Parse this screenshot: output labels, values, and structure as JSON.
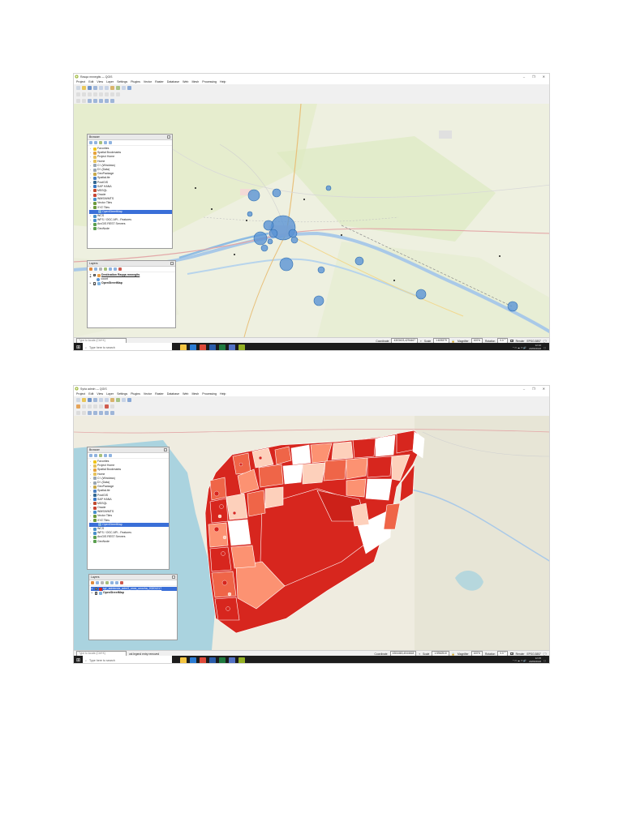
{
  "screenshot1": {
    "window_title": "Rasqa mnnegits — QGIS",
    "window_controls": [
      "–",
      "❐",
      "✕"
    ],
    "menu": [
      "Project",
      "Edit",
      "View",
      "Layer",
      "Settings",
      "Plugins",
      "Vector",
      "Raster",
      "Database",
      "Web",
      "Mesh",
      "Processing",
      "Help"
    ],
    "browser_panel": {
      "title": "Browser",
      "items": [
        {
          "label": "Favorites",
          "icon": "star-icon",
          "color": "#f0c419"
        },
        {
          "label": "Spatial Bookmarks",
          "icon": "bookmark-icon",
          "color": "#e6a23c"
        },
        {
          "label": "Project Home",
          "icon": "folder-icon",
          "color": "#e6c15a"
        },
        {
          "label": "Home",
          "icon": "folder-icon",
          "color": "#e6c15a"
        },
        {
          "label": "C:\\ (Windows)",
          "icon": "drive-icon",
          "color": "#9aa6b2"
        },
        {
          "label": "D:\\ (Data)",
          "icon": "drive-icon",
          "color": "#9aa6b2"
        },
        {
          "label": "GeoPackage",
          "icon": "geopackage-icon",
          "color": "#c7a84a"
        },
        {
          "label": "SpatiaLite",
          "icon": "spatialite-icon",
          "color": "#4a7fc1"
        },
        {
          "label": "PostGIS",
          "icon": "postgis-icon",
          "color": "#336791"
        },
        {
          "label": "SAP HANA",
          "icon": "database-icon",
          "color": "#3a78c3"
        },
        {
          "label": "MSSQL",
          "icon": "database-icon",
          "color": "#c14b2f"
        },
        {
          "label": "Oracle",
          "icon": "database-icon",
          "color": "#c74634"
        },
        {
          "label": "WMS/WMTS",
          "icon": "globe-icon",
          "color": "#4a8fc9"
        },
        {
          "label": "Vector Tiles",
          "icon": "grid-icon",
          "color": "#6c9a3c"
        },
        {
          "label": "XYZ Tiles",
          "icon": "grid-icon",
          "color": "#6c9a3c"
        },
        {
          "label": "OpenStreetMap",
          "icon": "map-icon",
          "color": "#7fb3e0",
          "selected": true
        },
        {
          "label": "WCS",
          "icon": "globe-icon",
          "color": "#4a8fc9"
        },
        {
          "label": "WFS / OGC API - Features",
          "icon": "globe-icon",
          "color": "#4a8fc9"
        },
        {
          "label": "ArcGIS REST Servers",
          "icon": "globe-icon",
          "color": "#5a9f4f"
        },
        {
          "label": "GeoNode",
          "icon": "globe-icon",
          "color": "#5a9f4f"
        }
      ]
    },
    "layers_panel": {
      "title": "Layers",
      "layers": [
        {
          "label": "Destination Raqqa mnnegits",
          "checked": true,
          "bold": true
        },
        {
          "label": "count",
          "checked": false,
          "legend": true
        },
        {
          "label": "OpenStreetMap",
          "checked": true,
          "bold": false
        }
      ]
    },
    "status": {
      "search_placeholder": "Type to locate (Ctrl+K)",
      "coordinate_label": "Coordinate",
      "coordinate_value": "4303403,4294467",
      "scale_label": "Scale",
      "scale_value": "1:605379",
      "magnifier_label": "Magnifier",
      "magnifier_value": "100%",
      "rotation_label": "Rotation",
      "rotation_value": "0.0 °",
      "render_label": "Render",
      "crs": "EPSG:3857"
    },
    "taskbar": {
      "search_placeholder": "Type here to search",
      "time": "12:10",
      "date": "20/06/2022"
    },
    "colors": {
      "bubble": "#4e8fd1",
      "bubble_stroke": "#2c6aab"
    }
  },
  "screenshot2": {
    "window_title": "Syria admin — QGIS",
    "window_controls": [
      "–",
      "❐",
      "✕"
    ],
    "menu": [
      "Project",
      "Edit",
      "View",
      "Layer",
      "Settings",
      "Plugins",
      "Vector",
      "Raster",
      "Database",
      "Web",
      "Mesh",
      "Processing",
      "Help"
    ],
    "browser_panel": {
      "title": "Browser",
      "items": [
        {
          "label": "Favorites",
          "icon": "star-icon",
          "color": "#f0c419"
        },
        {
          "label": "Project Home",
          "icon": "folder-icon",
          "color": "#e6c15a"
        },
        {
          "label": "Spatial Bookmarks",
          "icon": "bookmark-icon",
          "color": "#e6a23c"
        },
        {
          "label": "Home",
          "icon": "folder-icon",
          "color": "#e6c15a"
        },
        {
          "label": "C:\\ (Windows)",
          "icon": "drive-icon",
          "color": "#9aa6b2"
        },
        {
          "label": "D:\\ (Data)",
          "icon": "drive-icon",
          "color": "#9aa6b2"
        },
        {
          "label": "GeoPackage",
          "icon": "geopackage-icon",
          "color": "#c7a84a"
        },
        {
          "label": "SpatiaLite",
          "icon": "spatialite-icon",
          "color": "#4a7fc1"
        },
        {
          "label": "PostGIS",
          "icon": "postgis-icon",
          "color": "#336791"
        },
        {
          "label": "SAP HANA",
          "icon": "database-icon",
          "color": "#3a78c3"
        },
        {
          "label": "MSSQL",
          "icon": "database-icon",
          "color": "#c14b2f"
        },
        {
          "label": "Oracle",
          "icon": "database-icon",
          "color": "#c74634"
        },
        {
          "label": "WMS/WMTS",
          "icon": "globe-icon",
          "color": "#4a8fc9"
        },
        {
          "label": "Vector Tiles",
          "icon": "grid-icon",
          "color": "#6c9a3c"
        },
        {
          "label": "XYZ Tiles",
          "icon": "grid-icon",
          "color": "#6c9a3c"
        },
        {
          "label": "OpenStreetMap",
          "icon": "map-icon",
          "color": "#7fb3e0",
          "selected": true
        },
        {
          "label": "WCS",
          "icon": "globe-icon",
          "color": "#4a8fc9"
        },
        {
          "label": "WFS / OGC API - Features",
          "icon": "globe-icon",
          "color": "#4a8fc9"
        },
        {
          "label": "ArcGIS REST Servers",
          "icon": "globe-icon",
          "color": "#5a9f4f"
        },
        {
          "label": "GeoNode",
          "icon": "globe-icon",
          "color": "#5a9f4f"
        }
      ]
    },
    "layers_panel": {
      "title": "Layers",
      "layers": [
        {
          "label": "syr_admbnda_adm3_uncs_unocha_20201217",
          "checked": true,
          "selected": true
        },
        {
          "label": "OpenStreetMap",
          "checked": true
        }
      ]
    },
    "status": {
      "search_placeholder": "Type to locate (Ctrl+K)",
      "message": "ost legend entry removed",
      "coordinate_label": "Coordinate",
      "coordinate_value": "4304463,4044618",
      "scale_label": "Scale",
      "scale_value": "1:5962510",
      "magnifier_label": "Magnifier",
      "magnifier_value": "100%",
      "rotation_label": "Rotation",
      "rotation_value": "0.0 °",
      "render_label": "Render",
      "crs": "EPSG:3857"
    },
    "taskbar": {
      "search_placeholder": "Type here to search",
      "time": "12:45",
      "date": "20/06/2022"
    },
    "colors": {
      "dark": "#d7261e",
      "mid": "#ef6548",
      "light": "#fc9272",
      "pale": "#fdd0bb",
      "none": "#ffffff"
    }
  }
}
